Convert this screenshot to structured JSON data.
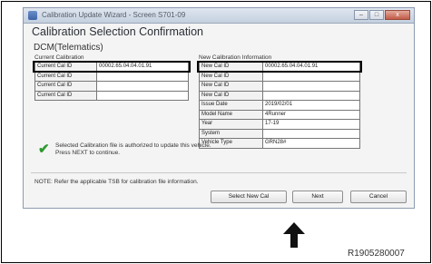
{
  "window": {
    "title": "Calibration Update Wizard - Screen S701-09",
    "minimize_label": "–",
    "maximize_label": "□",
    "close_label": "x"
  },
  "heading": "Calibration Selection Confirmation",
  "section": "DCM(Telematics)",
  "current": {
    "group_label": "Current Calibration",
    "rows": [
      {
        "label": "Current Cal ID",
        "value": "00002.65.04.04.01.91"
      },
      {
        "label": "Current Cal ID",
        "value": ""
      },
      {
        "label": "Current Cal ID",
        "value": ""
      },
      {
        "label": "Current Cal ID",
        "value": ""
      }
    ]
  },
  "new_info": {
    "group_label": "New Calibration Information",
    "rows": [
      {
        "label": "New Cal ID",
        "value": "00002.65.04.04.01.91"
      },
      {
        "label": "New Cal ID",
        "value": ""
      },
      {
        "label": "New Cal ID",
        "value": ""
      },
      {
        "label": "New Cal ID",
        "value": ""
      },
      {
        "label": "Issue Date",
        "value": "2019/02/01"
      },
      {
        "label": "Model Name",
        "value": "4Runner"
      },
      {
        "label": "Year",
        "value": "17-19"
      },
      {
        "label": "System",
        "value": ""
      },
      {
        "label": "Vehicle Type",
        "value": "GRN28#"
      }
    ]
  },
  "message": {
    "line1": "Selected Calibration file is authorized to update this vehicle.",
    "line2": "Press NEXT to continue."
  },
  "note": "NOTE: Refer the applicable TSB for calibration file information.",
  "buttons": {
    "select_new_cal": "Select New Cal",
    "next": "Next",
    "cancel": "Cancel"
  },
  "reference_id": "R1905280007",
  "colors": {
    "check": "#2c9a2c",
    "titlebar": "#c4d0df",
    "close": "#c35b47"
  }
}
